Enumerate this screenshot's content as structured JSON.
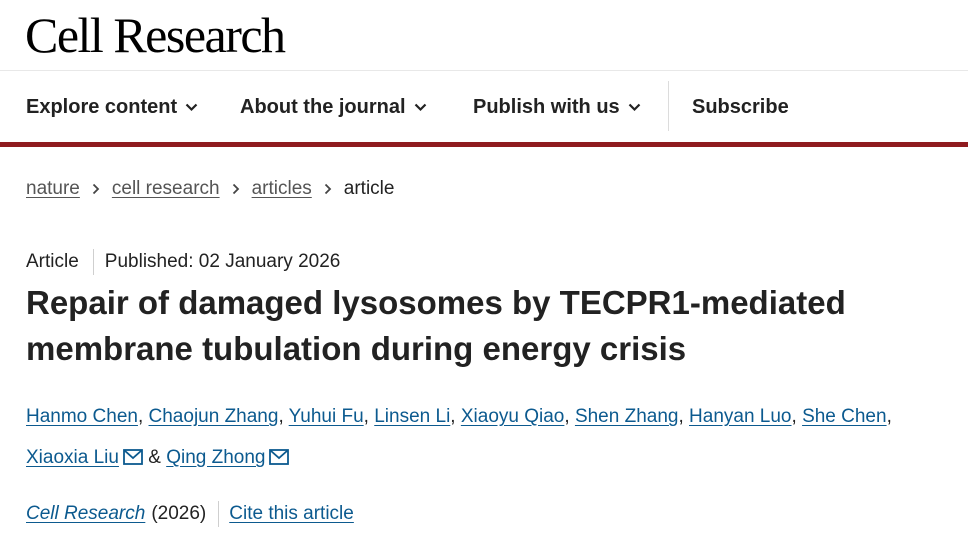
{
  "header": {
    "journal_title": "Cell Research"
  },
  "nav": {
    "items": [
      {
        "label": "Explore content"
      },
      {
        "label": "About the journal"
      },
      {
        "label": "Publish with us"
      }
    ],
    "subscribe_label": "Subscribe",
    "accent_color": "#8f1b1f"
  },
  "breadcrumb": {
    "items": [
      "nature",
      "cell research",
      "articles"
    ],
    "current": "article"
  },
  "article": {
    "type": "Article",
    "published": "Published: 02 January 2026",
    "title": "Repair of damaged lysosomes by TECPR1-mediated membrane tubulation during energy crisis",
    "authors": [
      "Hanmo Chen",
      "Chaojun Zhang",
      "Yuhui Fu",
      "Linsen Li",
      "Xiaoyu Qiao",
      "Shen Zhang",
      "Hanyan Luo",
      "She Chen",
      "Xiaoxia Liu",
      "Qing Zhong"
    ],
    "author_separator": ",",
    "author_conjunction": "&",
    "contact_icon": "mail-icon"
  },
  "citation": {
    "journal": "Cell Research",
    "year": "(2026)",
    "cite_label": "Cite this article"
  }
}
